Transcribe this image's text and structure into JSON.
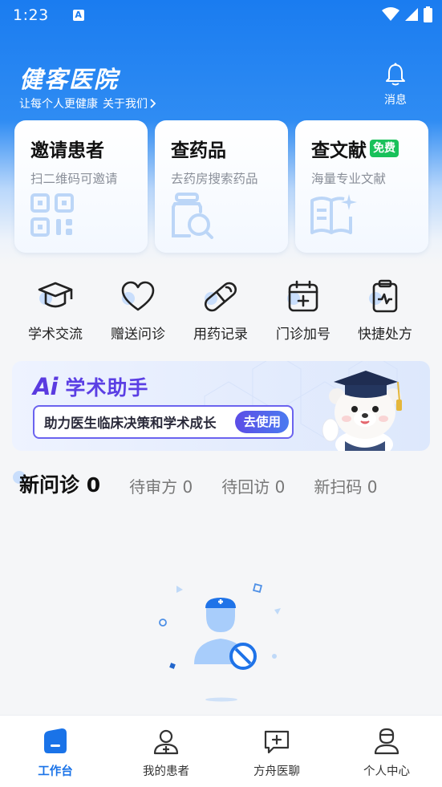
{
  "status_bar": {
    "time": "1:23",
    "notification_icon": "A"
  },
  "header": {
    "brand": "健客医院",
    "slogan": "让每个人更健康",
    "about": "关于我们",
    "message_label": "消息"
  },
  "cards": [
    {
      "title": "邀请患者",
      "subtitle": "扫二维码可邀请",
      "icon": "qr-code-icon"
    },
    {
      "title": "查药品",
      "subtitle": "去药房搜索药品",
      "icon": "medicine-search-icon"
    },
    {
      "title": "查文献",
      "badge": "免费",
      "subtitle": "海量专业文献",
      "icon": "book-icon"
    }
  ],
  "quick_actions": [
    {
      "label": "学术交流",
      "icon": "graduation-cap-icon"
    },
    {
      "label": "赠送问诊",
      "icon": "heart-icon"
    },
    {
      "label": "用药记录",
      "icon": "pill-icon"
    },
    {
      "label": "门诊加号",
      "icon": "calendar-plus-icon"
    },
    {
      "label": "快捷处方",
      "icon": "clipboard-pulse-icon"
    }
  ],
  "ai_banner": {
    "logo": "Ai",
    "title": "学术助手",
    "description": "助力医生临床决策和学术成长",
    "button": "去使用"
  },
  "tabs": [
    {
      "label": "新问诊",
      "count": "0",
      "active": true
    },
    {
      "label": "待审方",
      "count": "0",
      "active": false
    },
    {
      "label": "待回访",
      "count": "0",
      "active": false
    },
    {
      "label": "新扫码",
      "count": "0",
      "active": false
    }
  ],
  "bottom_nav": [
    {
      "label": "工作台",
      "icon": "workbench-icon",
      "active": true
    },
    {
      "label": "我的患者",
      "icon": "patients-icon",
      "active": false
    },
    {
      "label": "方舟医聊",
      "icon": "chat-plus-icon",
      "active": false
    },
    {
      "label": "个人中心",
      "icon": "profile-icon",
      "active": false
    }
  ],
  "colors": {
    "primary": "#1a73e8",
    "header_blue": "#1a7cf0",
    "ai_purple": "#5b3fe4",
    "free_badge": "#19c15a"
  }
}
